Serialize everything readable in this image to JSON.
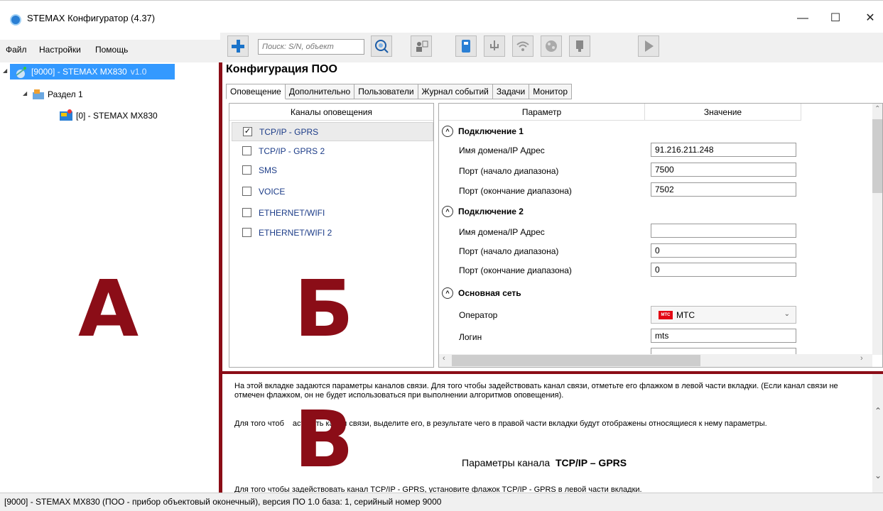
{
  "window": {
    "title": "STEMAX Конфигуратор (4.37)",
    "minimize": "—",
    "maximize": "☐",
    "close": "✕"
  },
  "menu": [
    "Файл",
    "Настройки",
    "Помощь"
  ],
  "toolbar": {
    "search_placeholder": "Поиск: S/N, объект",
    "icons": [
      "add-icon",
      "search-object-icon",
      "users-icon",
      "usb-icon",
      "usb-alt-icon",
      "wifi-icon",
      "globe-icon",
      "phone-icon",
      "play-icon"
    ]
  },
  "tree": {
    "root_id": "[9000] - STEMAX MX830",
    "root_version": "v1.0",
    "section": "Раздел 1",
    "device": "[0] - STEMAX MX830"
  },
  "config_title": "Конфигурация ПОО",
  "tabs": [
    "Оповещение",
    "Дополнительно",
    "Пользователи",
    "Журнал событий",
    "Задачи",
    "Монитор"
  ],
  "channels": {
    "header": "Каналы оповещения",
    "items": [
      {
        "label": "TCP/IP - GPRS",
        "checked": true
      },
      {
        "label": "TCP/IP - GPRS 2",
        "checked": false
      },
      {
        "label": "SMS",
        "checked": false
      },
      {
        "label": "VOICE",
        "checked": false
      },
      {
        "label": "ETHERNET/WIFI",
        "checked": false
      },
      {
        "label": "ETHERNET/WIFI 2",
        "checked": false
      }
    ]
  },
  "params": {
    "header_param": "Параметр",
    "header_value": "Значение",
    "sections": [
      {
        "title": "Подключение 1",
        "rows": [
          {
            "label": "Имя домена/IP Адрес",
            "value": "91.216.211.248"
          },
          {
            "label": "Порт (начало диапазона)",
            "value": "7500"
          },
          {
            "label": "Порт (окончание диапазона)",
            "value": "7502"
          }
        ]
      },
      {
        "title": "Подключение 2",
        "rows": [
          {
            "label": "Имя домена/IP Адрес",
            "value": ""
          },
          {
            "label": "Порт (начало диапазона)",
            "value": "0"
          },
          {
            "label": "Порт (окончание диапазона)",
            "value": "0"
          }
        ]
      },
      {
        "title": "Основная сеть",
        "rows": [
          {
            "label": "Оператор",
            "value": "МТС",
            "logo": "МТС"
          },
          {
            "label": "Логин",
            "value": "mts"
          }
        ]
      }
    ]
  },
  "help": {
    "p1": "На этой вкладке задаются параметры каналов связи. Для того чтобы задействовать канал связи, отметьте его флажком в левой части вкладки. (Если канал связи не отмечен флажком, он не будет использоваться при выполнении алгоритмов оповещения).",
    "p2_a": "Для того чтоб",
    "p2_b": "аст",
    "p2_c": "ить канал связи, выделите его, в результате чего в правой части вкладки будут отображены относящиеся к нему параметры.",
    "heading_prefix": "Параметры канала",
    "heading_bold": "TCP/IP – GPRS",
    "p3": "Для того чтобы задействовать канал TCP/IP - GPRS, установите флажок TCP/IP - GPRS в левой части вкладки."
  },
  "status": "[9000] - STEMAX MX830 (ПОО - прибор объектовый оконечный), версия ПО 1.0 база: 1, серийный номер 9000",
  "overlay_letters": {
    "a": "А",
    "b": "Б",
    "v": "В"
  },
  "colors": {
    "accent": "#3399ff",
    "divider": "#8b0d17",
    "channel_text": "#1c3c88"
  }
}
